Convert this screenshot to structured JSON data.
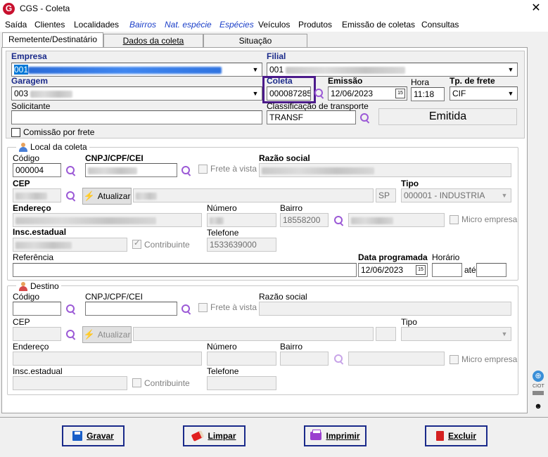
{
  "window": {
    "title": "CGS - Coleta",
    "close_glyph": "✕",
    "app_icon_letter": "G"
  },
  "menu": [
    "Saída",
    "Clientes",
    "Localidades",
    "Bairros",
    "Nat. espécie",
    "Espécies",
    "Veículos",
    "Produtos",
    "Emissão de coletas",
    "Consultas"
  ],
  "tabs": [
    "Remetente/Destinatário",
    "Dados da coleta",
    "Situação"
  ],
  "header": {
    "empresa_label": "Empresa",
    "empresa_value": "001",
    "filial_label": "Filial",
    "filial_value": "001",
    "garagem_label": "Garagem",
    "garagem_value": "003",
    "coleta_label": "Coleta",
    "coleta_value": "000087285",
    "emissao_label": "Emissão",
    "emissao_value": "12/06/2023",
    "hora_label": "Hora",
    "hora_value": "11:18",
    "tp_frete_label": "Tp. de frete",
    "tp_frete_value": "CIF",
    "solicitante_label": "Solicitante",
    "solicitante_value": "",
    "classificacao_label": "Classificação de transporte",
    "classificacao_value": "TRANSF",
    "status": "Emitida",
    "comissao_label": "Comissão por frete"
  },
  "local_coleta": {
    "title": "Local da coleta",
    "codigo_label": "Código",
    "codigo_value": "000004",
    "cnpj_label": "CNPJ/CPF/CEI",
    "cnpj_value": "",
    "frete_vista_label": "Frete à vista",
    "razao_label": "Razão social",
    "cep_label": "CEP",
    "atualizar_label": "Atualizar",
    "uf_value": "SP",
    "tipo_label": "Tipo",
    "tipo_value": "000001 - INDUSTRIA",
    "endereco_label": "Endereço",
    "numero_label": "Número",
    "bairro_label": "Bairro",
    "bairro_value": "18558200",
    "micro_label": "Micro empresa",
    "insc_label": "Insc.estadual",
    "contribuinte_label": "Contribuinte",
    "telefone_label": "Telefone",
    "telefone_value": "1533639000",
    "referencia_label": "Referência",
    "data_prog_label": "Data programada",
    "data_prog_value": "12/06/2023",
    "horario_label": "Horário",
    "ate_label": "até"
  },
  "destino": {
    "title": "Destino",
    "codigo_label": "Código",
    "cnpj_label": "CNPJ/CPF/CEI",
    "frete_vista_label": "Frete à vista",
    "razao_label": "Razão social",
    "cep_label": "CEP",
    "atualizar_label": "Atualizar",
    "tipo_label": "Tipo",
    "endereco_label": "Endereço",
    "numero_label": "Número",
    "bairro_label": "Bairro",
    "micro_label": "Micro empresa",
    "insc_label": "Insc.estadual",
    "contribuinte_label": "Contribuinte",
    "telefone_label": "Telefone"
  },
  "buttons": {
    "gravar": "Gravar",
    "limpar": "Limpar",
    "imprimir": "Imprimir",
    "excluir": "Excluir"
  },
  "side": {
    "ciot_label": "CIOT"
  }
}
